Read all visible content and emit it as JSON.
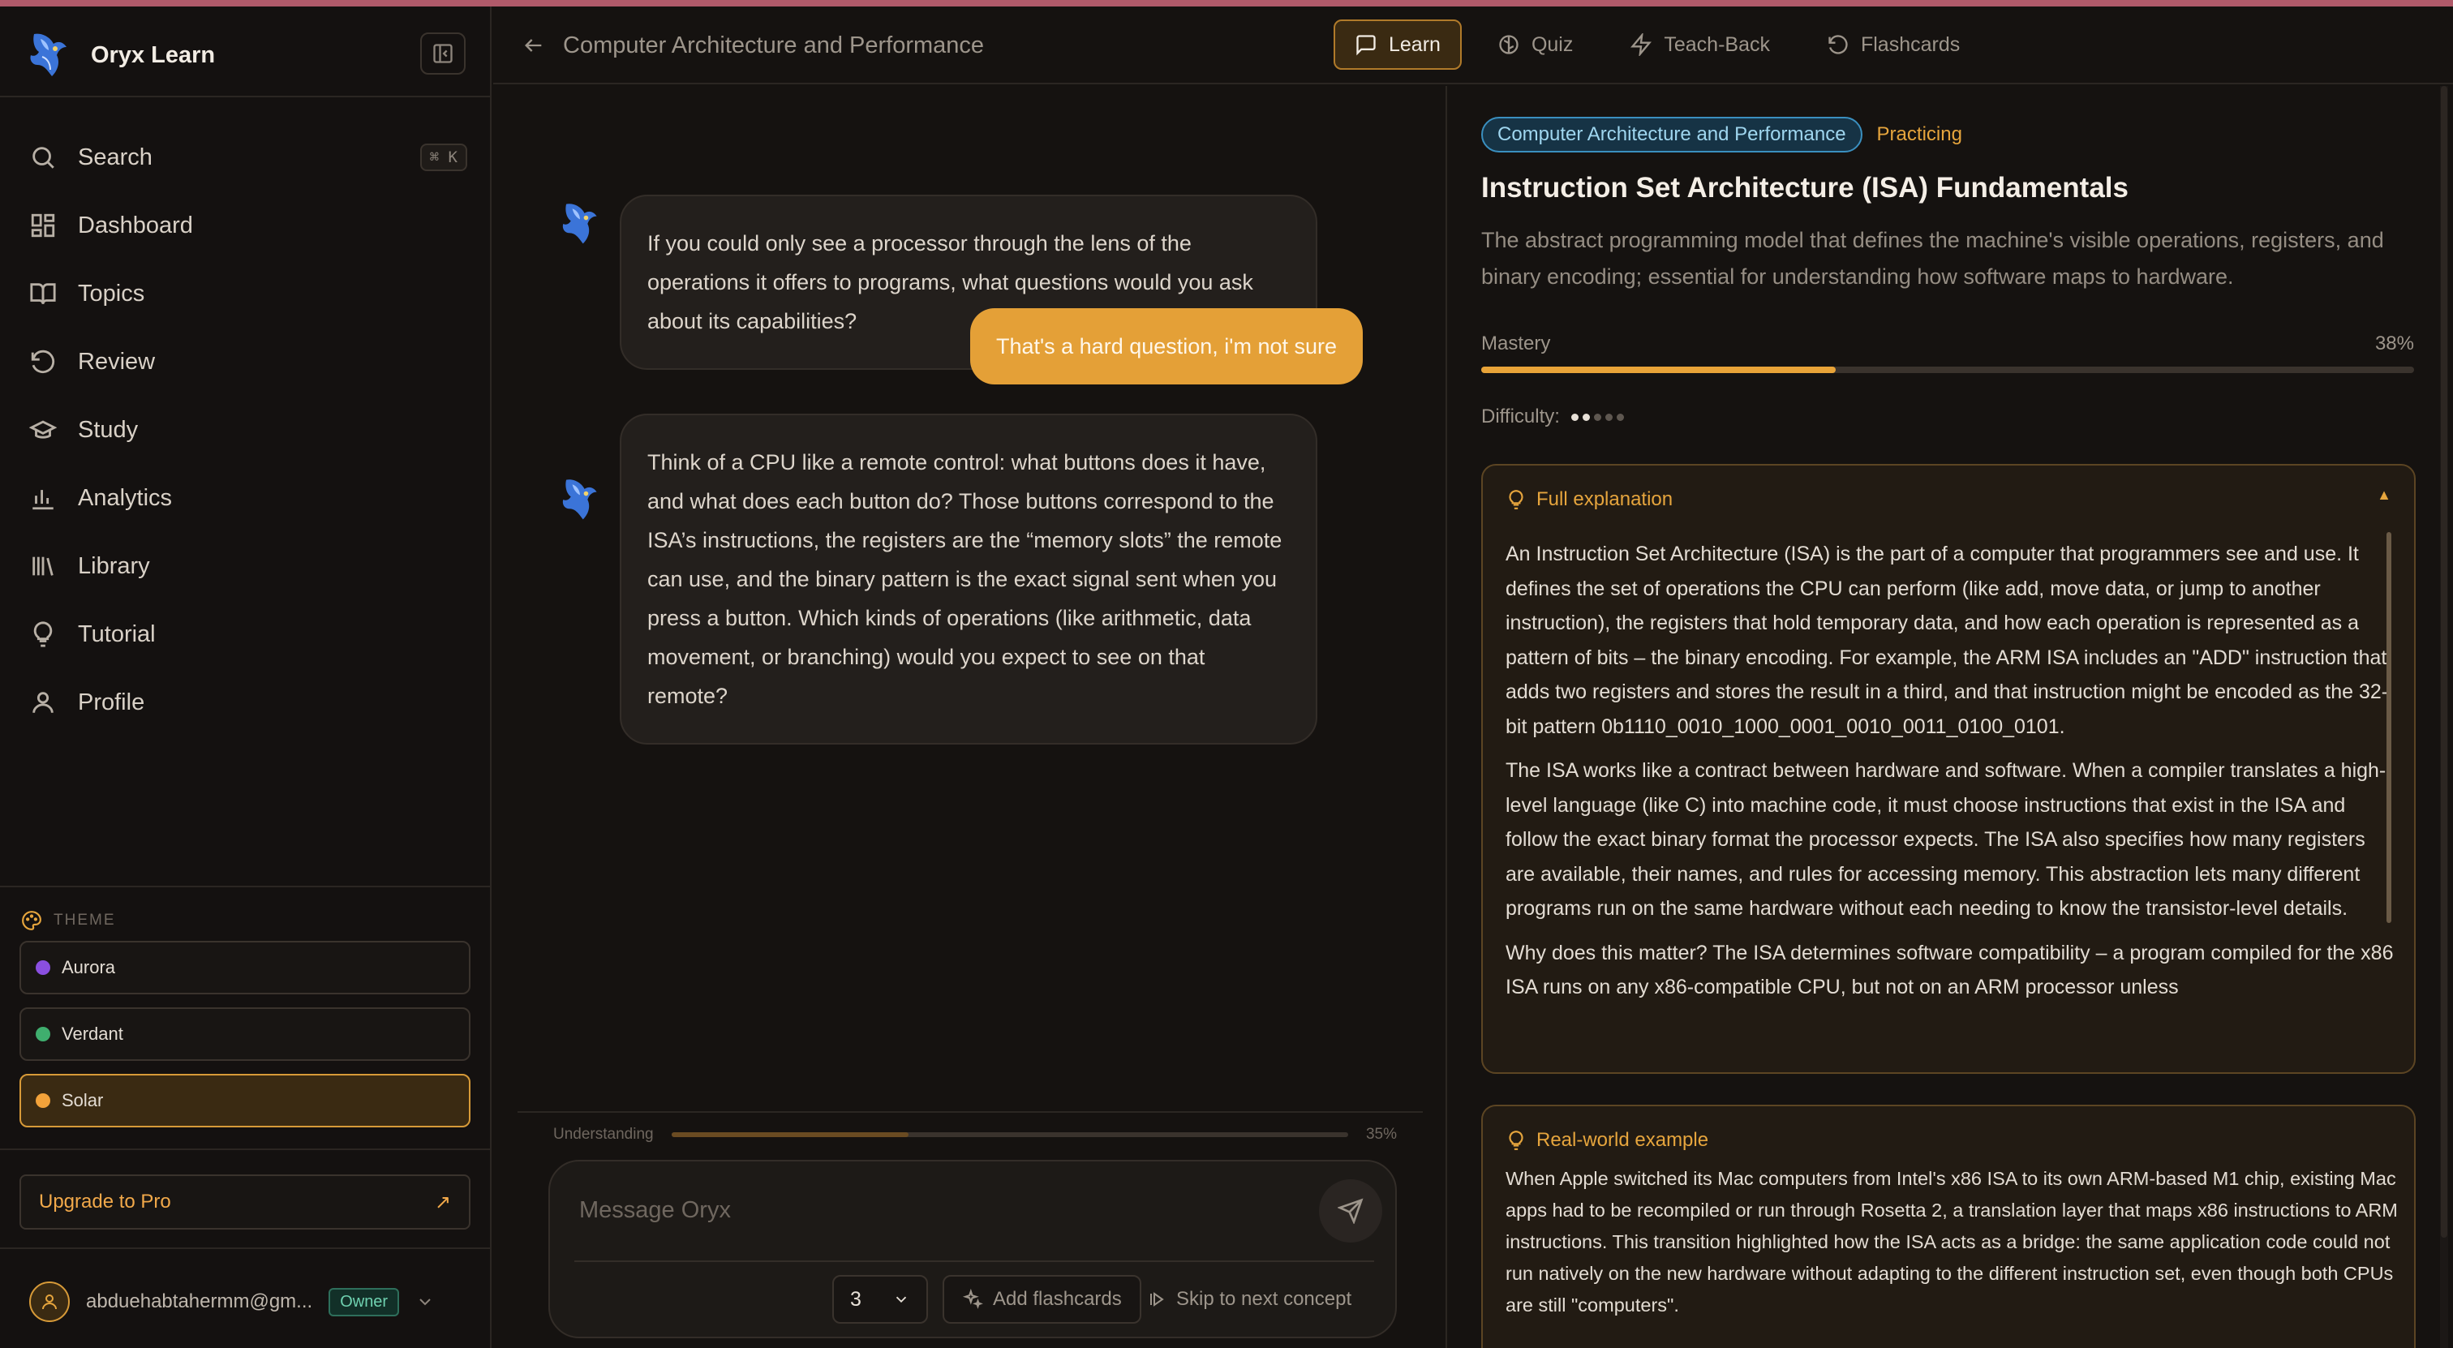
{
  "app": {
    "name": "Oryx Learn"
  },
  "search": {
    "label": "Search",
    "shortcut": "⌘ K"
  },
  "sidebar": {
    "items": [
      {
        "label": "Dashboard"
      },
      {
        "label": "Topics"
      },
      {
        "label": "Review"
      },
      {
        "label": "Study"
      },
      {
        "label": "Analytics"
      },
      {
        "label": "Library"
      },
      {
        "label": "Tutorial"
      },
      {
        "label": "Profile"
      }
    ]
  },
  "theme": {
    "label": "THEME",
    "options": [
      {
        "label": "Aurora",
        "color": "#8a4fe0"
      },
      {
        "label": "Verdant",
        "color": "#3fae6e"
      },
      {
        "label": "Solar",
        "color": "#f2a23a",
        "selected": true
      }
    ]
  },
  "upgrade": {
    "label": "Upgrade to Pro"
  },
  "account": {
    "email": "abduehabtahermm@gm...",
    "role": "Owner"
  },
  "header": {
    "course": "Computer Architecture and Performance",
    "tabs": [
      {
        "label": "Learn",
        "active": true
      },
      {
        "label": "Quiz"
      },
      {
        "label": "Teach-Back"
      },
      {
        "label": "Flashcards"
      }
    ]
  },
  "chat": {
    "messages": [
      {
        "role": "assistant",
        "text": "If you could only see a processor through the lens of the operations it offers to programs, what questions would you ask about its capabilities?"
      },
      {
        "role": "user",
        "text": "That's a hard question, i'm not sure"
      },
      {
        "role": "assistant",
        "text": "Think of a CPU like a remote control: what buttons does it have, and what does each button do? Those buttons correspond to the ISA’s instructions, the registers are the “memory slots” the remote can use, and the binary pattern is the exact signal sent when you press a button. Which kinds of operations (like arithmetic, data movement, or branching) would you expect to see on that remote?"
      }
    ],
    "understanding": {
      "label": "Understanding",
      "value": 35,
      "display": "35%"
    },
    "composer": {
      "placeholder": "Message Oryx",
      "count": "3",
      "add_flashcards": "Add flashcards",
      "skip": "Skip to next concept"
    }
  },
  "concept": {
    "topic_chip": "Computer Architecture and Performance",
    "status": "Practicing",
    "title": "Instruction Set Architecture (ISA) Fundamentals",
    "description": "The abstract programming model that defines the machine's visible operations, registers, and binary encoding; essential for understanding how software maps to hardware.",
    "mastery": {
      "label": "Mastery",
      "value": 38,
      "display": "38%"
    },
    "difficulty": {
      "label": "Difficulty:",
      "level": 2,
      "max": 5
    },
    "explanation": {
      "title": "Full explanation",
      "paragraphs": [
        "An Instruction Set Architecture (ISA) is the part of a computer that programmers see and use. It defines the set of operations the CPU can perform (like add, move data, or jump to another instruction), the registers that hold temporary data, and how each operation is represented as a pattern of bits – the binary encoding. For example, the ARM ISA includes an \"ADD\" instruction that adds two registers and stores the result in a third, and that instruction might be encoded as the 32-bit pattern 0b1110_0010_1000_0001_0010_0011_0100_0101.",
        "The ISA works like a contract between hardware and software. When a compiler translates a high-level language (like C) into machine code, it must choose instructions that exist in the ISA and follow the exact binary format the processor expects. The ISA also specifies how many registers are available, their names, and rules for accessing memory. This abstraction lets many different programs run on the same hardware without each needing to know the transistor-level details.",
        "Why does this matter? The ISA determines software compatibility – a program compiled for the x86 ISA runs on any x86-compatible CPU, but not on an ARM processor unless"
      ]
    },
    "example": {
      "title": "Real-world example",
      "text": "When Apple switched its Mac computers from Intel's x86 ISA to its own ARM-based M1 chip, existing Mac apps had to be recompiled or run through Rosetta 2, a translation layer that maps x86 instructions to ARM instructions. This transition highlighted how the ISA acts as a bridge: the same application code could not run natively on the new hardware without adapting to the different instruction set, even though both CPUs are still \"computers\"."
    }
  }
}
